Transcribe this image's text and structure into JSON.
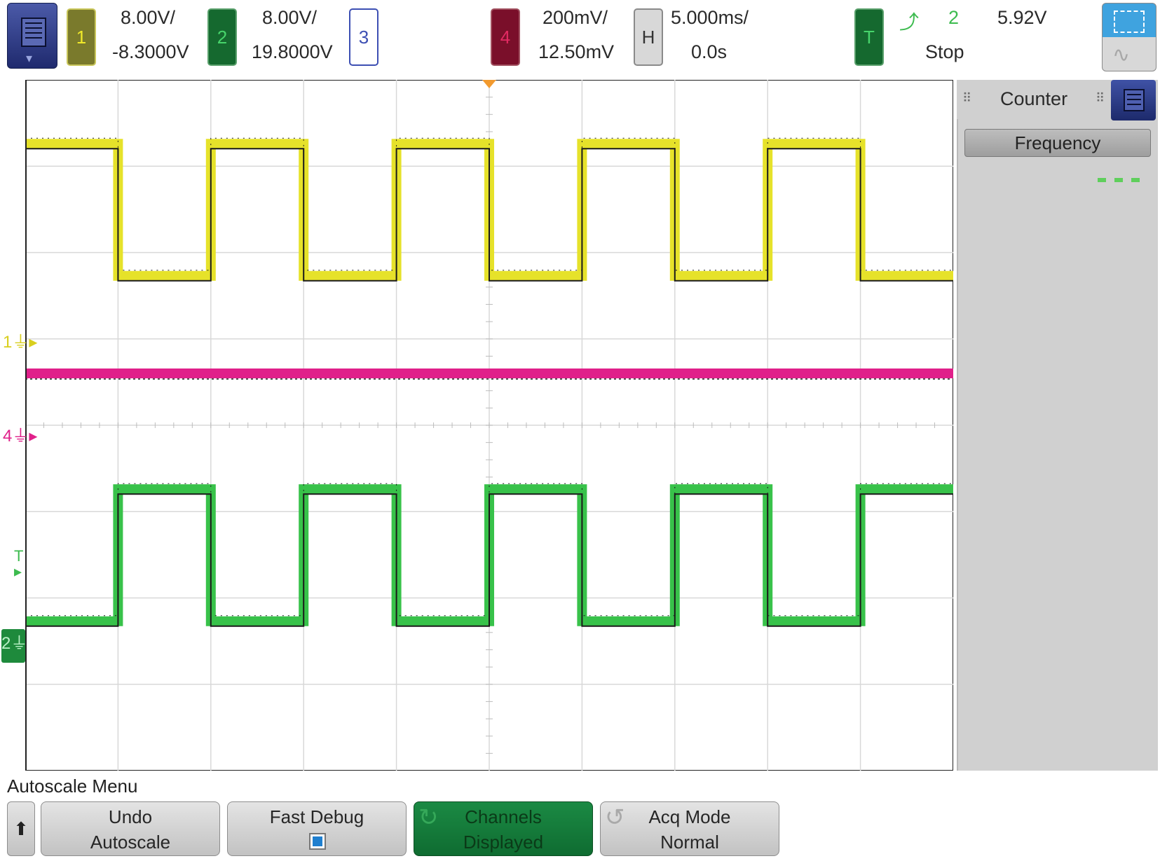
{
  "header": {
    "ch1": {
      "label": "1",
      "scale": "8.00V/",
      "offset": "-8.3000V"
    },
    "ch2": {
      "label": "2",
      "scale": "8.00V/",
      "offset": "19.8000V"
    },
    "ch3": {
      "label": "3"
    },
    "ch4": {
      "label": "4",
      "scale": "200mV/",
      "offset": "12.50mV"
    },
    "horizontal": {
      "label": "H",
      "scale": "5.000ms/",
      "delay": "0.0s"
    },
    "trigger": {
      "label": "T",
      "source": "2",
      "level": "5.92V",
      "status": "Stop"
    }
  },
  "markers": {
    "ch1_ground": "1",
    "ch4_ground": "4",
    "ch2_ground": "2",
    "trigger_level": "T"
  },
  "side_panel": {
    "title": "Counter",
    "frequency_button": "Frequency"
  },
  "bottom_menu": {
    "title": "Autoscale Menu",
    "keys": [
      {
        "line1": "Undo",
        "line2": "Autoscale"
      },
      {
        "line1": "Fast Debug",
        "checked": true
      },
      {
        "line1": "Channels",
        "line2": "Displayed",
        "active": true
      },
      {
        "line1": "Acq Mode",
        "line2": "Normal"
      }
    ]
  },
  "colors": {
    "ch1": "#e6e22a",
    "ch2": "#38c24a",
    "ch4": "#e0208a",
    "grid": "#d8d8d8",
    "trigger_marker": "#f29a2e"
  },
  "icons": [
    "main-menu-icon",
    "zoom-icon",
    "trigger-edge-icon",
    "up-arrow-icon",
    "checkbox-icon",
    "undo-icon"
  ]
}
